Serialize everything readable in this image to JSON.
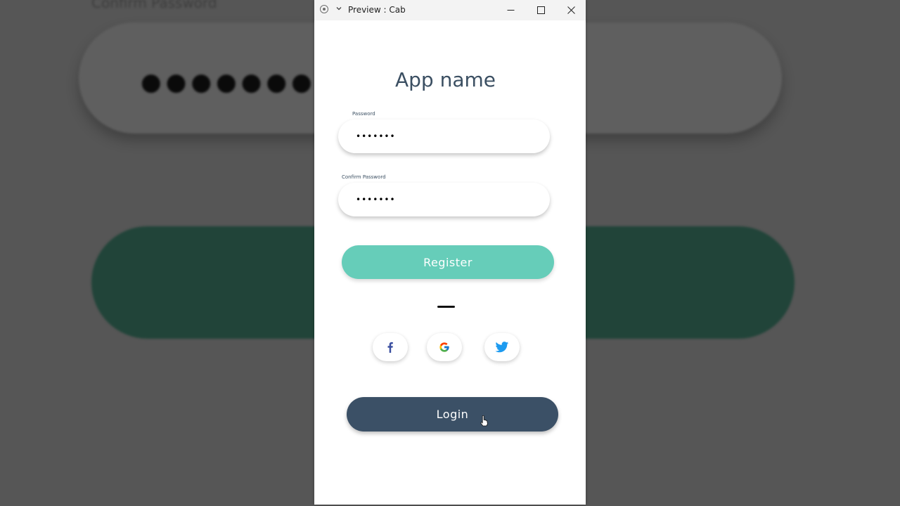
{
  "background": {
    "label": "Confirm Password",
    "dots": "●●●●●●●",
    "accent_color": "#214439",
    "color": "#565656"
  },
  "window": {
    "title": "Preview : Cab",
    "controls": {
      "minimize_icon": "minimize-icon",
      "maximize_icon": "maximize-icon",
      "close_icon": "close-icon"
    }
  },
  "app": {
    "title": "App name",
    "password_label": "Password",
    "password_value": "•••••••",
    "confirm_password_label": "Confirm Password",
    "confirm_password_value": "•••••••",
    "register_label": "Register",
    "login_label": "Login",
    "social": [
      {
        "name": "facebook",
        "icon": "facebook-icon",
        "color": "#3b5998"
      },
      {
        "name": "google",
        "icon": "google-icon",
        "color": "#4285f4"
      },
      {
        "name": "twitter",
        "icon": "twitter-icon",
        "color": "#1da1f2"
      }
    ]
  },
  "colors": {
    "register": "#66cdb9",
    "login": "#3b5066",
    "title_text": "#3b4f62"
  }
}
